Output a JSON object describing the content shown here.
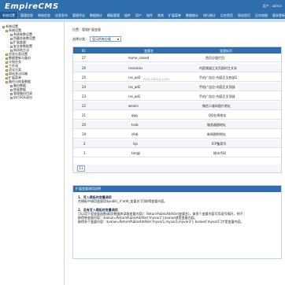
{
  "header": {
    "logo": "EmpireCMS",
    "user_text": "用户：admin"
  },
  "topnav": {
    "tabs": [
      {
        "label": "系统设置"
      },
      {
        "label": "管理信息"
      },
      {
        "label": "审核信息"
      },
      {
        "label": "信息发布"
      },
      {
        "label": "管理评论"
      },
      {
        "label": "数据统计"
      },
      {
        "label": "模板管理"
      },
      {
        "label": "插件"
      },
      {
        "label": "用户"
      },
      {
        "label": "插件"
      },
      {
        "label": "其他"
      },
      {
        "label": "扩展菜单"
      },
      {
        "label": "数据统计"
      },
      {
        "label": "排行统计"
      },
      {
        "label": "后台首页"
      },
      {
        "label": "网站首页"
      },
      {
        "label": "后台地图"
      },
      {
        "label": "版本更新"
      }
    ]
  },
  "sidebar": {
    "items": [
      {
        "label": "系统设置"
      },
      {
        "label": "系统设置"
      },
      {
        "label": "系统参数设置"
      },
      {
        "label": "伪静态参数设置"
      },
      {
        "label": "扩展变量"
      },
      {
        "label": "安全参数配置"
      },
      {
        "label": "网站地方法"
      },
      {
        "label": "信息分类设置"
      },
      {
        "label": "数据更新与备份"
      },
      {
        "label": "计划任务"
      },
      {
        "label": "工作流"
      },
      {
        "label": "优化方案"
      },
      {
        "label": "网站多访问端"
      },
      {
        "label": "扩展菜单"
      },
      {
        "label": "备份与恢复数据"
      },
      {
        "label": "备份数据"
      },
      {
        "label": "恢复数据"
      },
      {
        "label": "管理备份目录"
      },
      {
        "label": "执行SQL语句"
      }
    ]
  },
  "main": {
    "breadcrumb": "位置：管理扩展变量",
    "filter": {
      "label": "选择分类：",
      "selected": "显示所有分类"
    },
    "grid": {
      "columns": [
        "ID",
        "变量名",
        "变量标识"
      ],
      "rows": [
        {
          "id": "27",
          "name": "home_closed",
          "desc": "首页分类栏目"
        },
        {
          "id": "26",
          "name": "rssnanzu",
          "desc": "内容频道正文页面时主文本"
        },
        {
          "id": "25",
          "name": "rss_ad3",
          "desc": "手机广告位-内容正文底部2"
        },
        {
          "id": "24",
          "name": "rss_ad2",
          "desc": "手机广告位-内容正文顶部"
        },
        {
          "id": "23",
          "name": "rss_ad1",
          "desc": "手机广告位-内容正文顶部"
        },
        {
          "id": "22",
          "name": "weixin",
          "desc": "微信二维码图片地址"
        },
        {
          "id": "21",
          "name": "qqq",
          "desc": "QQ在线地址"
        },
        {
          "id": "20",
          "name": "tcvb",
          "desc": "服务器图地址"
        },
        {
          "id": "19",
          "name": "sfxb",
          "desc": "新闻图附地址"
        },
        {
          "id": "2",
          "name": "icp",
          "desc": "ICP备案号"
        },
        {
          "id": "1",
          "name": "tongji",
          "desc": "统计代码"
        }
      ],
      "page": "11"
    },
    "watermark": "moyublog.com",
    "info": {
      "title": "扩展变量调用说明",
      "h1": "1、写入模板的变量调用",
      "p1": "在模板中调用变量用$public_r['add_变量名']可取得变量内容。",
      "h2": "2、没有写入模板的变量调用",
      "p2": "可以用下面变量函数调用(数据库读取变量内容)：ReturnPublicAddVar(变量名)，取多个变量内容可用逗号隔开，例子：",
      "p3": "取得单变量内容：$value=ReturnPublicAddVar('myvar1');$value就是变量内容。",
      "p4": "取得多个变量内容：$value=ReturnPublicAddVar('myvar1,myvar2,myvar3'); $value['myvar1']才是变量内容。"
    }
  }
}
